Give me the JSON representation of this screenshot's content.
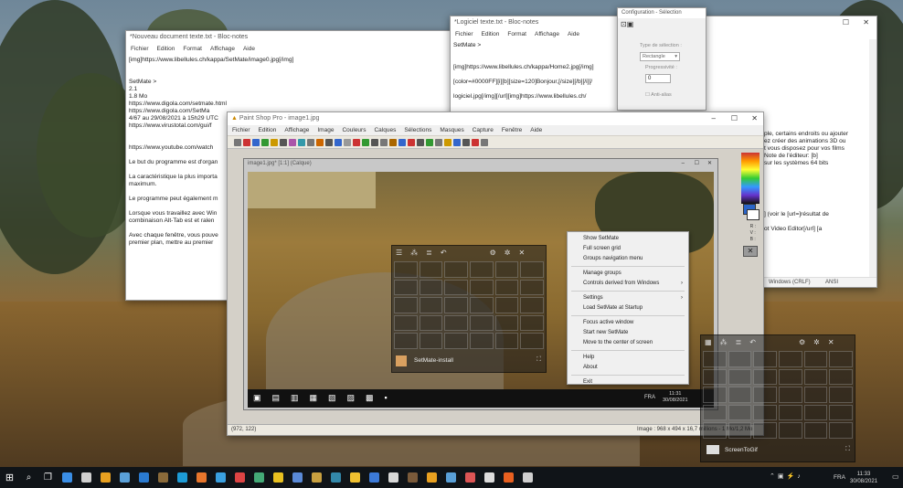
{
  "notepad1": {
    "title": "*Nouveau document texte.txt - Bloc-notes",
    "menu": [
      "Fichier",
      "Edition",
      "Format",
      "Affichage",
      "Aide"
    ],
    "lines": [
      "[img]https://www.libellules.ch/kappa/SetMate/image0.jpg[/img]",
      "",
      "",
      "SetMate >",
      "2.1",
      "1.8 Mo",
      "https://www.digola.com/setmate.html",
      "https://www.digola.com/SetMa",
      "4/67 au 29/08/2021 à 15h29 UTC",
      "https://www.virustotal.com/gui/f",
      "",
      "",
      "https://www.youtube.com/watch",
      "",
      "Le but du programme est d'organ",
      "",
      "La caractéristique la plus importa",
      "maximum.",
      "",
      "Le programme peut également m",
      "",
      "Lorsque vous travaillez avec Win",
      "combinaison Alt-Tab est et ralen",
      "",
      "Avec chaque fenêtre, vous pouve",
      "premier plan, mettre au premier"
    ]
  },
  "notepad2": {
    "title": "*Logiciel texte.txt - Bloc-notes",
    "menu": [
      "Fichier",
      "Edition",
      "Format",
      "Affichage",
      "Aide"
    ],
    "lines": [
      "SetMate >",
      "",
      "",
      "[img]https://www.libellules.ch/kappa/Home2.jpg[/img]",
      "",
      "[color=#0000FF][i][b][size=120]Bonjour,[/size][/b][/i][/",
      "",
      "logiciel.jpg[/img][/url][img]https://www.libellules.ch/"
    ],
    "right_lines": [
      "ple, certains endroits ou ajouter",
      "ez créer des animations 3D ou",
      "t vous disposez pour vos films",
      "Note de l'éditeur: [b]",
      "sur les systèmes 64 bits",
      "",
      "",
      "",
      "",
      "",
      "",
      "] (voir le [url=]résultat de",
      "",
      "ot Video Editor[/url] [a"
    ],
    "status": [
      "Windows (CRLF)",
      "ANSI"
    ]
  },
  "config": {
    "title": "Configuration - Sélection",
    "type_label": "Type de sélection :",
    "type_value": "Rectangle",
    "prog_label": "Progressivité :",
    "prog_value": "0",
    "check_label": "Anti-alias"
  },
  "psp": {
    "title": "Paint Shop Pro - image1.jpg",
    "menu": [
      "Fichier",
      "Edition",
      "Affichage",
      "Image",
      "Couleurs",
      "Calques",
      "Sélections",
      "Masques",
      "Capture",
      "Fenêtre",
      "Aide"
    ],
    "image_title": "image1.jpg* [1:1] (Calque)",
    "status_left": "(972, 122)",
    "status_right": "Image : 968 x 494 x 16,7 millions - 1 Mo/1,2 Mo",
    "fg_bg": [
      "R :",
      "V :",
      "B :"
    ]
  },
  "setmate_small": {
    "label": "SetMate-install",
    "icons": [
      "menu-icon",
      "tree-icon",
      "list-icon",
      "undo-icon",
      "settings-icon",
      "gear-icon",
      "close-icon"
    ]
  },
  "setmate_big": {
    "label": "ScreenToGif"
  },
  "context_menu": [
    {
      "label": "Show SetMate",
      "sub": false
    },
    {
      "label": "Full screen grid",
      "sub": false
    },
    {
      "label": "Groups navigation menu",
      "sub": false
    },
    {
      "sep": true
    },
    {
      "label": "Manage groups",
      "sub": false
    },
    {
      "label": "Controls derived from Windows",
      "sub": true
    },
    {
      "sep": true
    },
    {
      "label": "Settings",
      "sub": true
    },
    {
      "label": "Load SetMate at Startup",
      "sub": false
    },
    {
      "sep": true
    },
    {
      "label": "Focus active window",
      "sub": false
    },
    {
      "label": "Start new SetMate",
      "sub": false
    },
    {
      "label": "Move to the center of screen",
      "sub": false
    },
    {
      "sep": true
    },
    {
      "label": "Help",
      "sub": false
    },
    {
      "label": "About",
      "sub": false
    },
    {
      "sep": true
    },
    {
      "label": "Exit",
      "sub": false
    }
  ],
  "inner_taskbar": {
    "lang": "FRA",
    "time": "11:31",
    "date": "30/08/2021"
  },
  "taskbar": {
    "lang": "FRA",
    "time": "11:33",
    "date": "30/08/2021"
  },
  "colors": {
    "taskbar": "#101418",
    "accent": "#2a64c8"
  }
}
